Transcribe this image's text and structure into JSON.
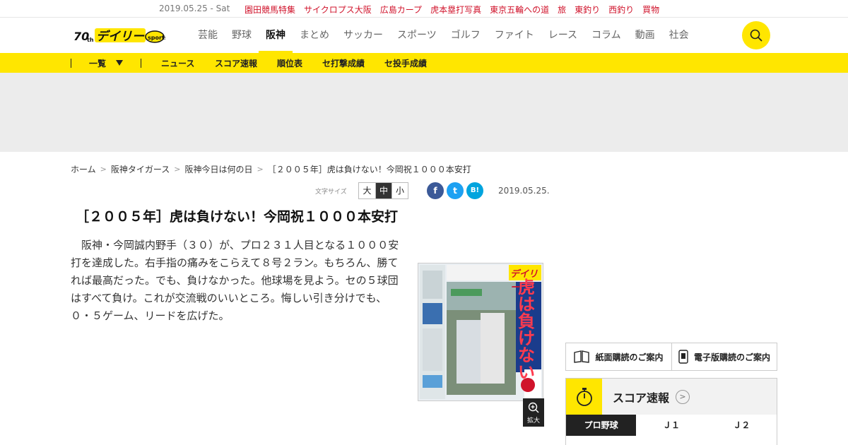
{
  "topbar": {
    "date": "2019.05.25 - Sat",
    "links": [
      "園田競馬特集",
      "サイクロプス大阪",
      "広島カープ",
      "虎本塁打写真",
      "東京五輪への道",
      "旅",
      "東釣り",
      "西釣り",
      "買物"
    ]
  },
  "header": {
    "logo_text": "デイリー",
    "nav": [
      "芸能",
      "野球",
      "阪神",
      "まとめ",
      "サッカー",
      "スポーツ",
      "ゴルフ",
      "ファイト",
      "レース",
      "コラム",
      "動画",
      "社会"
    ],
    "active_nav": "阪神"
  },
  "subnav": {
    "list_label": "一覧",
    "items": [
      "ニュース",
      "スコア速報",
      "順位表",
      "セ打撃成績",
      "セ投手成績"
    ]
  },
  "breadcrumb": [
    "ホーム",
    "阪神タイガース",
    "阪神今日は何の日",
    "［２００５年］虎は負けない！今岡祝１０００本安打"
  ],
  "tools": {
    "font_size_label": "文字サイズ",
    "sizes": [
      "大",
      "中",
      "小"
    ],
    "share": [
      "f",
      "t",
      "B!"
    ],
    "date": "2019.05.25."
  },
  "article": {
    "title": "［２００５年］虎は負けない！今岡祝１０００本安打",
    "body": "阪神・今岡誠内野手（３０）が、プロ２３１人目となる１０００安打を達成した。右手指の痛みをこらえて８号２ラン。もちろん、勝てれば最高だった。でも、負けなかった。他球場を見よう。セの５球団はすべて負け。これが交流戦のいいところ。悔しい引き分けでも、０・５ゲーム、リードを広げた。",
    "paper_headline": "虎は負けない",
    "paper_masthead": "デイリー",
    "zoom_label": "拡大"
  },
  "sidebar": {
    "subscribe": [
      "紙面購読のご案内",
      "電子版購読のご案内"
    ],
    "score_title": "スコア速報",
    "score_tabs": [
      "プロ野球",
      "Ｊ１",
      "Ｊ２"
    ]
  },
  "colors": {
    "brand_yellow": "#ffe600",
    "link_red": "#d0132b",
    "facebook": "#3b5998",
    "twitter": "#1da1f2",
    "hatena": "#00a4de"
  }
}
